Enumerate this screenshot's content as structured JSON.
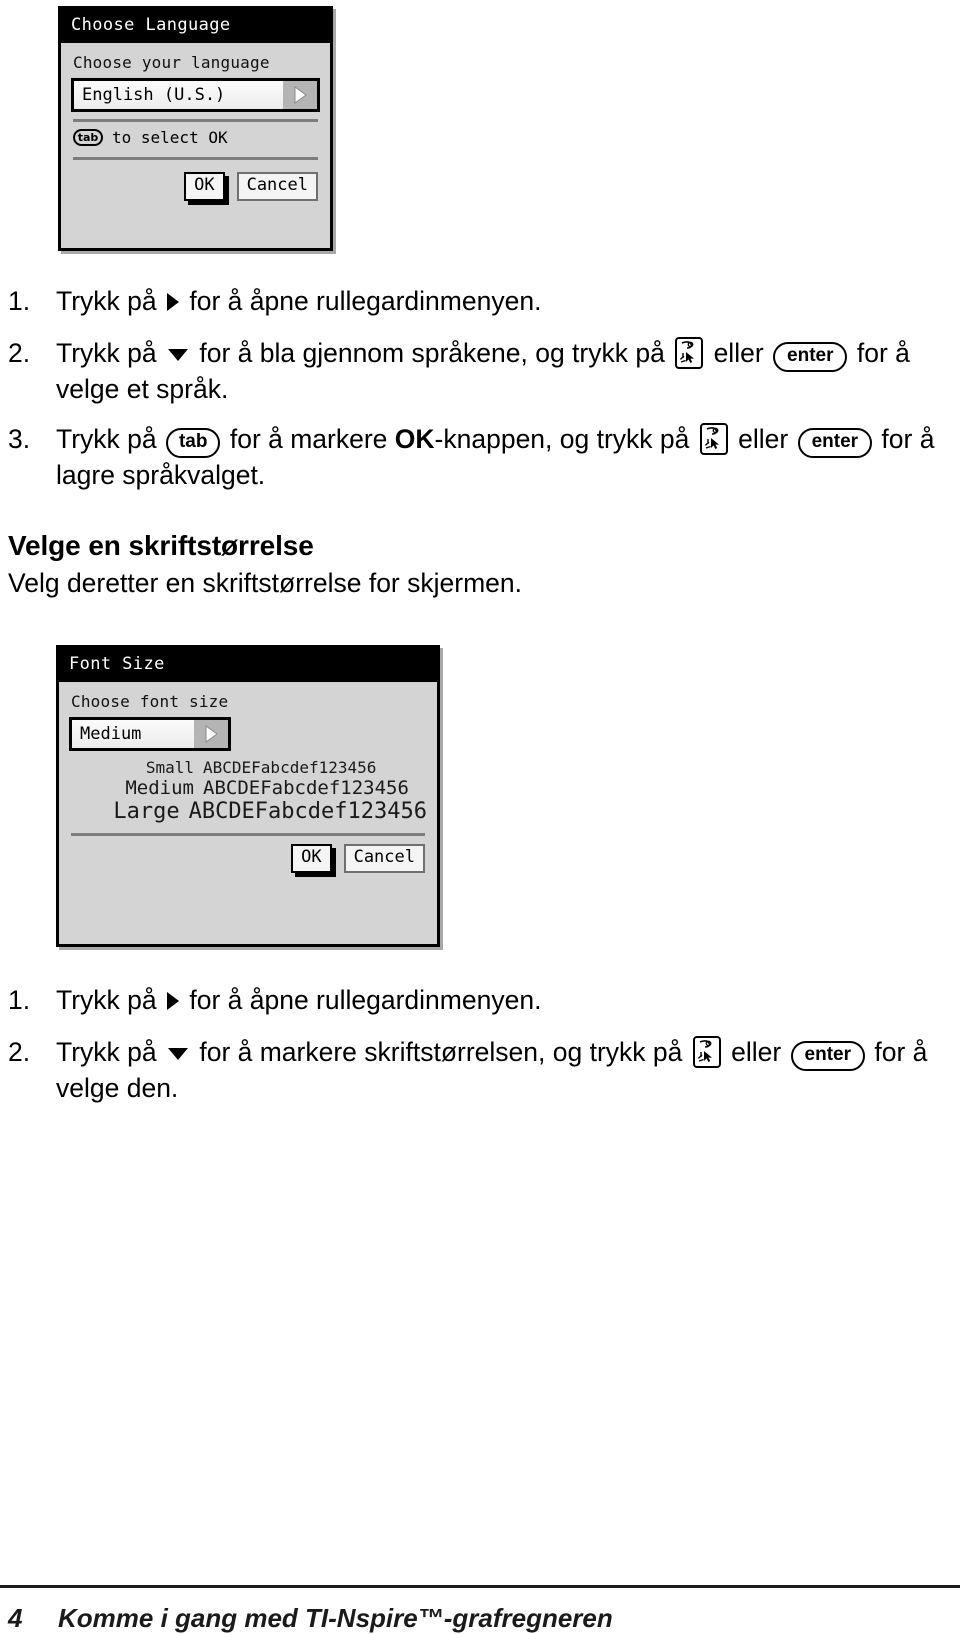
{
  "page": {
    "footer_page_number": "4",
    "footer_title": "Komme i gang med TI-Nspire™-grafregneren"
  },
  "language_dialog": {
    "title": "Choose Language",
    "prompt": "Choose your language",
    "selected_value": "English (U.S.)",
    "dropdown_arrow_icon": "triangle-right-icon",
    "hint_key": "tab",
    "hint_text": "to select OK",
    "ok_label": "OK",
    "cancel_label": "Cancel"
  },
  "language_steps": [
    {
      "number": "1.",
      "parts": [
        {
          "type": "text",
          "value": "Trykk på "
        },
        {
          "type": "icon",
          "value": "triangle-right-icon"
        },
        {
          "type": "text",
          "value": " for å åpne rullegardinmenyen."
        }
      ]
    },
    {
      "number": "2.",
      "parts": [
        {
          "type": "text",
          "value": "Trykk på "
        },
        {
          "type": "icon",
          "value": "triangle-down-icon"
        },
        {
          "type": "text",
          "value": " for å bla gjennom språkene, og trykk på "
        },
        {
          "type": "icon",
          "value": "click-key-icon"
        },
        {
          "type": "text",
          "value": " eller "
        },
        {
          "type": "key",
          "value": "enter"
        },
        {
          "type": "text",
          "value": " for å velge et språk."
        }
      ]
    },
    {
      "number": "3.",
      "parts": [
        {
          "type": "text",
          "value": "Trykk på "
        },
        {
          "type": "key",
          "value": "tab"
        },
        {
          "type": "text",
          "value": " for å markere "
        },
        {
          "type": "bold",
          "value": "OK"
        },
        {
          "type": "text",
          "value": "-knappen, og trykk på "
        },
        {
          "type": "icon",
          "value": "click-key-icon"
        },
        {
          "type": "text",
          "value": " eller "
        },
        {
          "type": "key",
          "value": "enter"
        },
        {
          "type": "text",
          "value": " for å lagre språkvalget."
        }
      ]
    }
  ],
  "font_section": {
    "heading": "Velge en skriftstørrelse",
    "subtext": "Velg deretter en skriftstørrelse for skjermen."
  },
  "font_dialog": {
    "title": "Font Size",
    "prompt": "Choose font size",
    "selected_value": "Medium",
    "dropdown_arrow_icon": "triangle-right-icon",
    "samples": [
      {
        "label": "Small",
        "text": "ABCDEFabcdef123456"
      },
      {
        "label": "Medium",
        "text": "ABCDEFabcdef123456"
      },
      {
        "label": "Large",
        "text": "ABCDEFabcdef123456"
      }
    ],
    "ok_label": "OK",
    "cancel_label": "Cancel"
  },
  "font_steps": [
    {
      "number": "1.",
      "parts": [
        {
          "type": "text",
          "value": "Trykk på "
        },
        {
          "type": "icon",
          "value": "triangle-right-icon"
        },
        {
          "type": "text",
          "value": " for å åpne rullegardinmenyen."
        }
      ]
    },
    {
      "number": "2.",
      "parts": [
        {
          "type": "text",
          "value": "Trykk på "
        },
        {
          "type": "icon",
          "value": "triangle-down-icon"
        },
        {
          "type": "text",
          "value": " for å markere skriftstørrelsen, og trykk på "
        },
        {
          "type": "icon",
          "value": "click-key-icon"
        },
        {
          "type": "text",
          "value": " eller "
        },
        {
          "type": "key",
          "value": "enter"
        },
        {
          "type": "text",
          "value": " for å velge den."
        }
      ]
    }
  ],
  "colors": {
    "dialog_face": "#d4d4d4",
    "titlebar": "#000000",
    "combo_arrow": "#b4b4b4",
    "rule": "#7d7d7d",
    "text": "#000000"
  }
}
